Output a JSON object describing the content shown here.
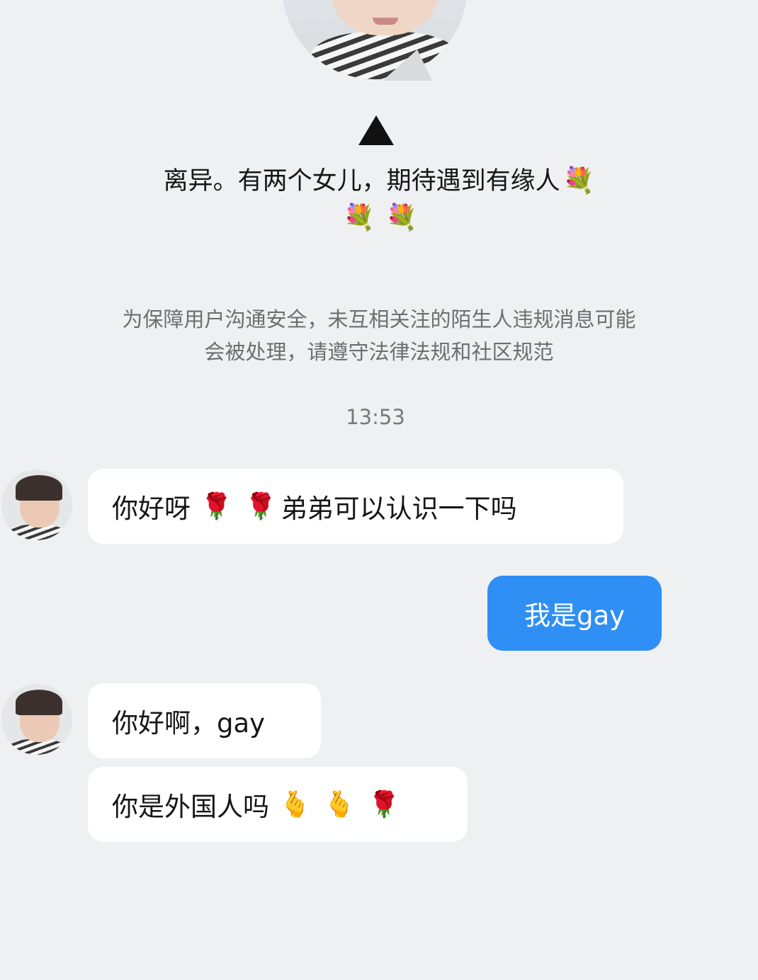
{
  "profile": {
    "photo_icon": "profile-photo",
    "bio_text": "离异。有两个女儿，期待遇到有缘人",
    "bio_emoji": [
      "💐",
      "💐",
      "💐"
    ]
  },
  "notice": {
    "line1": "为保障用户沟通安全，未互相关注的陌生人违规消息可能",
    "line2": "会被处理，请遵守法律法规和社区规范"
  },
  "timestamp": "13:53",
  "messages": [
    {
      "direction": "incoming",
      "text": "你好呀",
      "emoji_mid": [
        "🌹",
        "🌹"
      ],
      "text2": "弟弟可以认识一下吗"
    },
    {
      "direction": "outgoing",
      "text": "我是gay"
    },
    {
      "direction": "incoming",
      "text": "你好啊，gay"
    },
    {
      "direction": "incoming",
      "text": "你是外国人吗",
      "emoji": [
        "🫰",
        "🫰",
        "🌹"
      ]
    }
  ],
  "colors": {
    "background": "#eff0f1",
    "bubble_incoming": "#ffffff",
    "bubble_outgoing": "#2f8ff5",
    "notice_text": "#6e6e6e"
  }
}
